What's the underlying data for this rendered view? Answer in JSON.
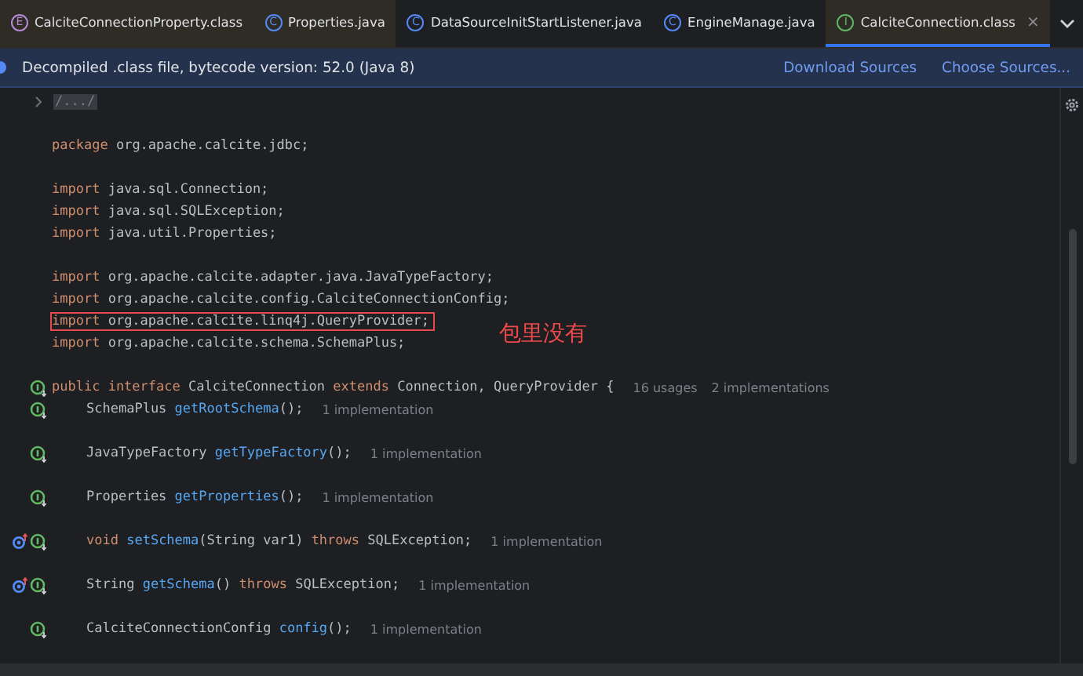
{
  "tabs": [
    {
      "label": "CalciteConnectionProperty.class",
      "icon_letter": "E",
      "kind": "enum",
      "library": true,
      "selected": false
    },
    {
      "label": "Properties.java",
      "icon_letter": "C",
      "kind": "class",
      "library": true,
      "selected": false
    },
    {
      "label": "DataSourceInitStartListener.java",
      "icon_letter": "C",
      "kind": "class",
      "library": false,
      "selected": false
    },
    {
      "label": "EngineManage.java",
      "icon_letter": "C",
      "kind": "class",
      "library": false,
      "selected": false
    },
    {
      "label": "CalciteConnection.class",
      "icon_letter": "I",
      "kind": "interface",
      "library": true,
      "selected": true,
      "close": "×"
    }
  ],
  "banner": {
    "text": "Decompiled .class file, bytecode version: 52.0 (Java 8)",
    "links": [
      "Download Sources",
      "Choose Sources..."
    ]
  },
  "lines": [
    {
      "kind": "fold",
      "text": "/.../"
    },
    {
      "kind": "blank"
    },
    {
      "kind": "code",
      "tokens": [
        {
          "kind": "kw",
          "s": "package "
        },
        {
          "kind": "plain",
          "s": "org.apache.calcite.jdbc;"
        }
      ]
    },
    {
      "kind": "blank"
    },
    {
      "kind": "code",
      "tokens": [
        {
          "kind": "kw",
          "s": "import "
        },
        {
          "kind": "plain",
          "s": "java.sql.Connection;"
        }
      ]
    },
    {
      "kind": "code",
      "tokens": [
        {
          "kind": "kw",
          "s": "import "
        },
        {
          "kind": "plain",
          "s": "java.sql.SQLException;"
        }
      ]
    },
    {
      "kind": "code",
      "tokens": [
        {
          "kind": "kw",
          "s": "import "
        },
        {
          "kind": "plain",
          "s": "java.util.Properties;"
        }
      ]
    },
    {
      "kind": "blank"
    },
    {
      "kind": "code",
      "tokens": [
        {
          "kind": "kw",
          "s": "import "
        },
        {
          "kind": "plain",
          "s": "org.apache.calcite.adapter.java.JavaTypeFactory;"
        }
      ]
    },
    {
      "kind": "code",
      "tokens": [
        {
          "kind": "kw",
          "s": "import "
        },
        {
          "kind": "plain",
          "s": "org.apache.calcite.config.CalciteConnectionConfig;"
        }
      ]
    },
    {
      "kind": "code",
      "boxed": true,
      "note": "包里没有",
      "tokens": [
        {
          "kind": "kw",
          "s": "import "
        },
        {
          "kind": "plain",
          "s": "org.apache.calcite.linq4j.QueryProvider;"
        }
      ]
    },
    {
      "kind": "code",
      "tokens": [
        {
          "kind": "kw",
          "s": "import "
        },
        {
          "kind": "plain",
          "s": "org.apache.calcite.schema.SchemaPlus;"
        }
      ]
    },
    {
      "kind": "blank"
    },
    {
      "kind": "code",
      "gutter": [
        {
          "kind": "implemented"
        }
      ],
      "hints": [
        "16 usages",
        "2 implementations"
      ],
      "tokens": [
        {
          "kind": "kw",
          "s": "public interface "
        },
        {
          "kind": "plain",
          "s": "CalciteConnection "
        },
        {
          "kind": "kw",
          "s": "extends "
        },
        {
          "kind": "plain",
          "s": "Connection, QueryProvider {"
        }
      ],
      "children": [
        {
          "kind": "code",
          "gutter": [
            {
              "kind": "implemented"
            }
          ],
          "hints": [
            "1 implementation"
          ],
          "tokens": [
            {
              "kind": "plain",
              "s": "SchemaPlus "
            },
            {
              "kind": "fn",
              "s": "getRootSchema"
            },
            {
              "kind": "plain",
              "s": "();"
            }
          ]
        },
        {
          "kind": "blank"
        },
        {
          "kind": "code",
          "gutter": [
            {
              "kind": "implemented"
            }
          ],
          "hints": [
            "1 implementation"
          ],
          "tokens": [
            {
              "kind": "plain",
              "s": "JavaTypeFactory "
            },
            {
              "kind": "fn",
              "s": "getTypeFactory"
            },
            {
              "kind": "plain",
              "s": "();"
            }
          ]
        },
        {
          "kind": "blank"
        },
        {
          "kind": "code",
          "gutter": [
            {
              "kind": "implemented"
            }
          ],
          "hints": [
            "1 implementation"
          ],
          "tokens": [
            {
              "kind": "plain",
              "s": "Properties "
            },
            {
              "kind": "fn",
              "s": "getProperties"
            },
            {
              "kind": "plain",
              "s": "();"
            }
          ]
        },
        {
          "kind": "blank"
        },
        {
          "kind": "code",
          "gutter": [
            {
              "kind": "overriding"
            },
            {
              "kind": "implemented"
            }
          ],
          "hints": [
            "1 implementation"
          ],
          "tokens": [
            {
              "kind": "kw",
              "s": "void "
            },
            {
              "kind": "fn",
              "s": "setSchema"
            },
            {
              "kind": "plain",
              "s": "(String var1) "
            },
            {
              "kind": "kw",
              "s": "throws "
            },
            {
              "kind": "plain",
              "s": "SQLException;"
            }
          ]
        },
        {
          "kind": "blank"
        },
        {
          "kind": "code",
          "gutter": [
            {
              "kind": "overriding"
            },
            {
              "kind": "implemented"
            }
          ],
          "hints": [
            "1 implementation"
          ],
          "tokens": [
            {
              "kind": "plain",
              "s": "String "
            },
            {
              "kind": "fn",
              "s": "getSchema"
            },
            {
              "kind": "plain",
              "s": "() "
            },
            {
              "kind": "kw",
              "s": "throws "
            },
            {
              "kind": "plain",
              "s": "SQLException;"
            }
          ]
        },
        {
          "kind": "blank"
        },
        {
          "kind": "code",
          "gutter": [
            {
              "kind": "implemented"
            }
          ],
          "hints": [
            "1 implementation"
          ],
          "tokens": [
            {
              "kind": "plain",
              "s": "CalciteConnectionConfig "
            },
            {
              "kind": "fn",
              "s": "config"
            },
            {
              "kind": "plain",
              "s": "();"
            }
          ]
        }
      ]
    }
  ]
}
